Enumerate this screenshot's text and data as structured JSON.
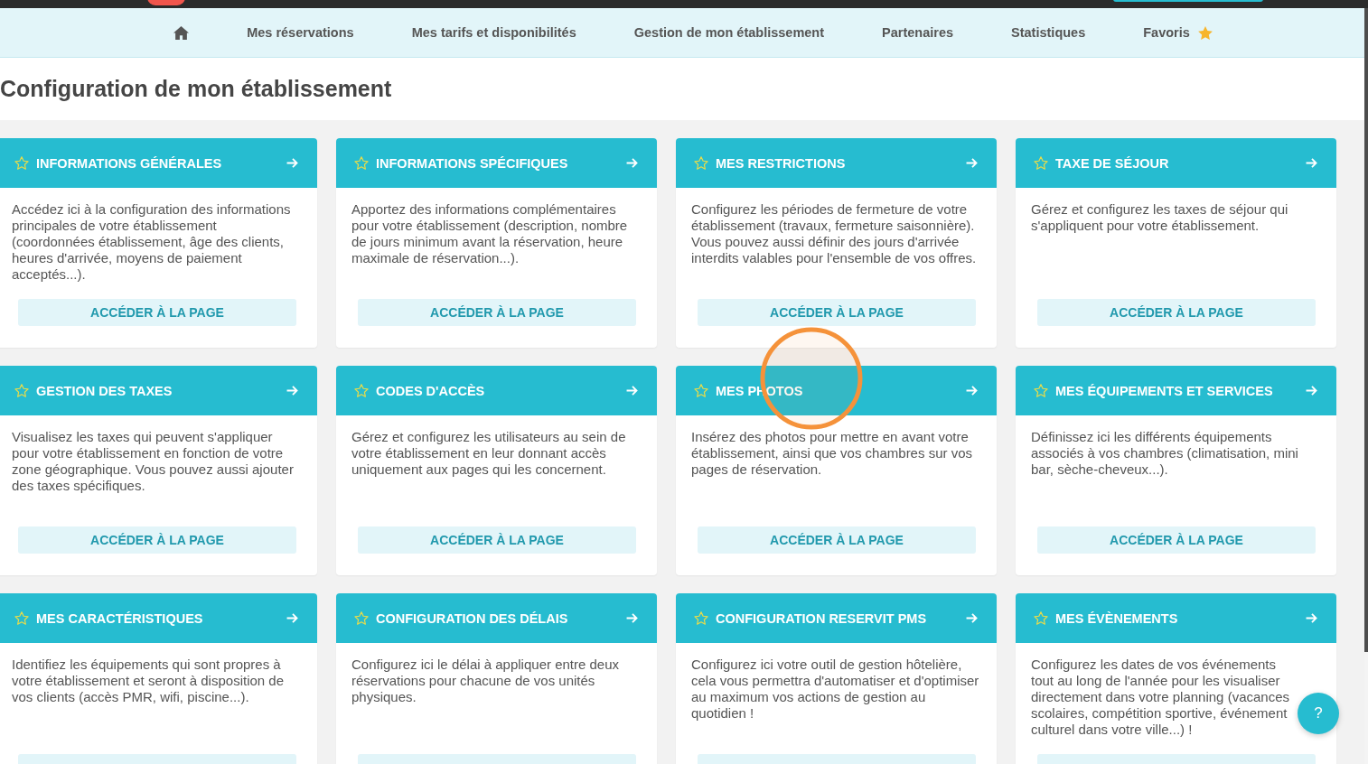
{
  "nav": {
    "items": [
      {
        "kind": "home"
      },
      {
        "kind": "link",
        "label": "Mes réservations"
      },
      {
        "kind": "link",
        "label": "Mes tarifs et disponibilités"
      },
      {
        "kind": "link",
        "label": "Gestion de mon établissement"
      },
      {
        "kind": "link",
        "label": "Partenaires"
      },
      {
        "kind": "link",
        "label": "Statistiques"
      },
      {
        "kind": "favorites",
        "label": "Favoris"
      }
    ]
  },
  "page_title": "Configuration de mon établissement",
  "cards": [
    {
      "title": "INFORMATIONS GÉNÉRALES",
      "favorite": false,
      "description": "Accédez ici à la configuration des informations principales de votre établissement (coordonnées établissement, âge des clients, heures d'arrivée, moyens de paiement acceptés...).",
      "button": "ACCÉDER À LA PAGE"
    },
    {
      "title": "INFORMATIONS SPÉCIFIQUES",
      "favorite": false,
      "description": "Apportez des informations complémentaires pour votre établissement (description, nombre de jours minimum avant la réservation, heure maximale de réservation...).",
      "button": "ACCÉDER À LA PAGE"
    },
    {
      "title": "MES RESTRICTIONS",
      "favorite": false,
      "description": "Configurez les périodes de fermeture de votre établissement (travaux, fermeture saisonnière). Vous pouvez aussi définir des jours d'arrivée interdits valables pour l'ensemble de vos offres.",
      "button": "ACCÉDER À LA PAGE"
    },
    {
      "title": "TAXE DE SÉJOUR",
      "favorite": false,
      "description": "Gérez et configurez les taxes de séjour qui s'appliquent pour votre établissement.",
      "button": "ACCÉDER À LA PAGE"
    },
    {
      "title": "GESTION DES TAXES",
      "favorite": false,
      "description": "Visualisez les taxes qui peuvent s'appliquer pour votre établissement en fonction de votre zone géographique. Vous pouvez aussi ajouter des taxes spécifiques.",
      "button": "ACCÉDER À LA PAGE"
    },
    {
      "title": "CODES D'ACCÈS",
      "favorite": false,
      "description": "Gérez et configurez les utilisateurs au sein de votre établissement en leur donnant accès uniquement aux pages qui les concernent.",
      "button": "ACCÉDER À LA PAGE"
    },
    {
      "title": "MES PHOTOS",
      "favorite": false,
      "description": "Insérez des photos pour mettre en avant votre établissement, ainsi que vos chambres sur vos pages de réservation.",
      "button": "ACCÉDER À LA PAGE"
    },
    {
      "title": "MES ÉQUIPEMENTS ET SERVICES",
      "favorite": false,
      "description": "Définissez ici les différents équipements associés à vos chambres (climatisation, mini bar, sèche-cheveux...).",
      "button": "ACCÉDER À LA PAGE"
    },
    {
      "title": "MES CARACTÉRISTIQUES",
      "favorite": false,
      "description": "Identifiez les équipements qui sont propres à votre établissement et seront à disposition de vos clients (accès PMR, wifi, piscine...)."
    },
    {
      "title": "CONFIGURATION DES DÉLAIS",
      "favorite": false,
      "description": "Configurez ici le délai à appliquer entre deux réservations pour chacune de vos unités physiques."
    },
    {
      "title": "CONFIGURATION RESERVIT PMS",
      "favorite": false,
      "description": "Configurez ici votre outil de gestion hôtelière, cela vous permettra d'automatiser et d'optimiser au maximum vos actions de gestion au quotidien !"
    },
    {
      "title": "MES ÉVÈNEMENTS",
      "favorite": false,
      "description": "Configurez les dates de vos événements tout au long de l'année pour les visualiser directement dans votre planning (vacances scolaires, compétition sportive, événement culturel dans votre ville...) !"
    }
  ],
  "help_button": "?"
}
